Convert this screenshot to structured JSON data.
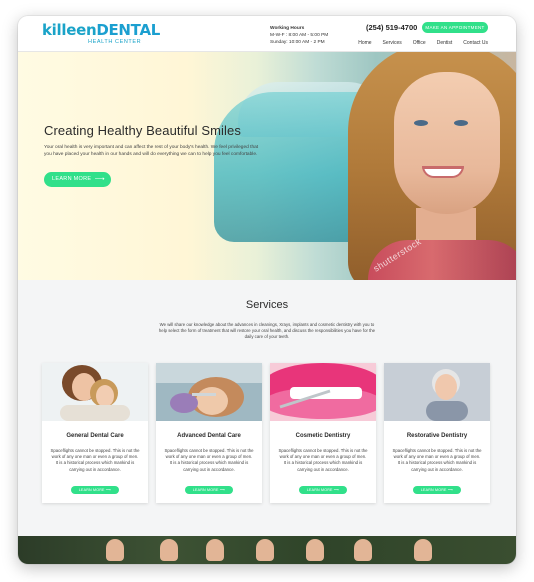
{
  "header": {
    "logo_main_1": "killeen",
    "logo_main_2": "DENTAL",
    "logo_sub": "HEALTH CENTER",
    "hours_title": "Working Hours",
    "hours_line1": "M-W-F : 8:00 AM - 5:00 PM",
    "hours_line2": "Sunday: 10:00 AM - 2 PM",
    "phone": "(254) 519-4700",
    "appointment_label": "MAKE AN APPOINTMENT",
    "nav": [
      "Home",
      "Services",
      "Office",
      "Dentist",
      "Contact Us"
    ]
  },
  "hero": {
    "title": "Creating Healthy Beautiful Smiles",
    "text": "Your oral health is very important and can affect the rest of your body's health. We feel privileged that you have placed your health in our hands and will do everything we can to help you feel comfortable.",
    "button_label": "LEARN MORE",
    "button_arrow": "⟶",
    "watermark": "shutterstock"
  },
  "services": {
    "title": "Services",
    "intro": "We will share our knowledge about the advances in cleanings, Xrays, implants and cosmetic dentistry with you to help select the form of treatment that will restore your oral health, and discuss the responsibilities you have for the daily care of your teeth.",
    "cards": [
      {
        "title": "General Dental Care",
        "text": "Spaceflights cannot be stopped. This is not the work of any one man or even a group of men. It is a historical process which mankind is carrying out in accordance.",
        "button": "LEARN MORE ⟶"
      },
      {
        "title": "Advanced Dental Care",
        "text": "Spaceflights cannot be stopped. This is not the work of any one man or even a group of men. It is a historical process which mankind is carrying out in accordance.",
        "button": "LEARN MORE ⟶"
      },
      {
        "title": "Cosmetic Dentistry",
        "text": "Spaceflights cannot be stopped. This is not the work of any one man or even a group of men. It is a historical process which mankind is carrying out in accordance.",
        "button": "LEARN MORE ⟶"
      },
      {
        "title": "Restorative Dentistry",
        "text": "Spaceflights cannot be stopped. This is not the work of any one man or even a group of men. It is a historical process which mankind is carrying out in accordance.",
        "button": "LEARN MORE ⟶"
      }
    ]
  },
  "colors": {
    "accent": "#31e08a",
    "brand": "#1aa3c8"
  }
}
